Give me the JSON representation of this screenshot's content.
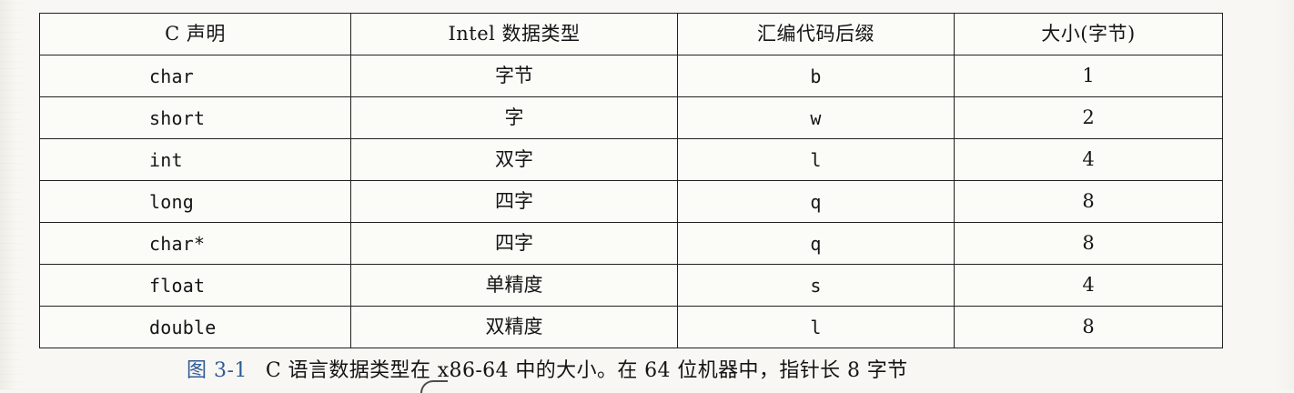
{
  "table": {
    "headers": [
      "C 声明",
      "Intel 数据类型",
      "汇编代码后缀",
      "大小(字节)"
    ],
    "rows": [
      {
        "c_decl": "char",
        "intel_type": "字节",
        "suffix": "b",
        "size": "1"
      },
      {
        "c_decl": "short",
        "intel_type": "字",
        "suffix": "w",
        "size": "2"
      },
      {
        "c_decl": "int",
        "intel_type": "双字",
        "suffix": "l",
        "size": "4"
      },
      {
        "c_decl": "long",
        "intel_type": "四字",
        "suffix": "q",
        "size": "8"
      },
      {
        "c_decl": "char*",
        "intel_type": "四字",
        "suffix": "q",
        "size": "8"
      },
      {
        "c_decl": "float",
        "intel_type": "单精度",
        "suffix": "s",
        "size": "4"
      },
      {
        "c_decl": "double",
        "intel_type": "双精度",
        "suffix": "l",
        "size": "8"
      }
    ]
  },
  "caption": {
    "label": "图 3-1",
    "text": "C 语言数据类型在 x86-64 中的大小。在 64 位机器中，指针长 8 字节"
  }
}
